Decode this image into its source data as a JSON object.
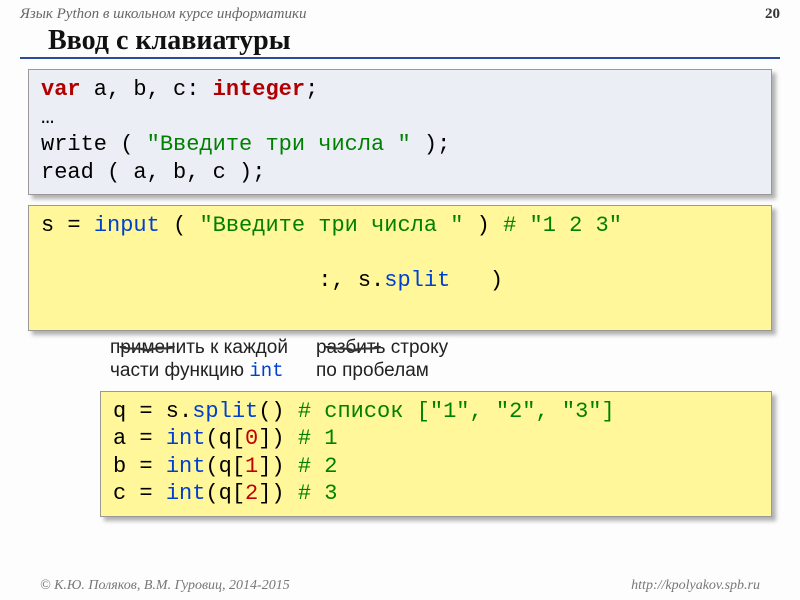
{
  "header": {
    "course": "Язык Python в школьном курсе информатики",
    "page": "20"
  },
  "title": "Ввод с клавиатуры",
  "pascal": {
    "l1_var": "var",
    "l1_rest": " a, b, c: ",
    "l1_type": "integer",
    "l1_semi": ";",
    "l2": "…",
    "l3_a": "write ( ",
    "l3_str": "\"Введите три числа \"",
    "l3_b": " );",
    "l4": "read ( a, b, c );"
  },
  "py1": {
    "l1_a": "s = ",
    "l1_input": "input",
    "l1_b": " ( ",
    "l1_str": "\"Введите три числа \"",
    "l1_c": " ) ",
    "l1_comment": "# \"1 2 3\"",
    "l2_a": "                 :, s.",
    "l2_split": "split",
    "l2_b": "   )"
  },
  "annot": {
    "left1": "применить к каждой",
    "left2_a": "части функцию ",
    "left2_int": "int",
    "right1": "разбить строку",
    "right2": "по пробелам"
  },
  "py2": {
    "l1_a": "q = s.",
    "l1_split": "split",
    "l1_b": "()  ",
    "l1_comment": "# список [\"1\", \"2\", \"3\"]",
    "l2_a": "a = ",
    "l2_int": "int",
    "l2_b": "(q[",
    "l2_idx": "0",
    "l2_c": "])  ",
    "l2_comment": "# 1",
    "l3_a": "b = ",
    "l3_int": "int",
    "l3_b": "(q[",
    "l3_idx": "1",
    "l3_c": "])  ",
    "l3_comment": "# 2",
    "l4_a": "c = ",
    "l4_int": "int",
    "l4_b": "(q[",
    "l4_idx": "2",
    "l4_c": "])  ",
    "l4_comment": "# 3"
  },
  "footer": {
    "left": "© К.Ю. Поляков, В.М. Гуровиц, 2014-2015",
    "right": "http://kpolyakov.spb.ru"
  }
}
